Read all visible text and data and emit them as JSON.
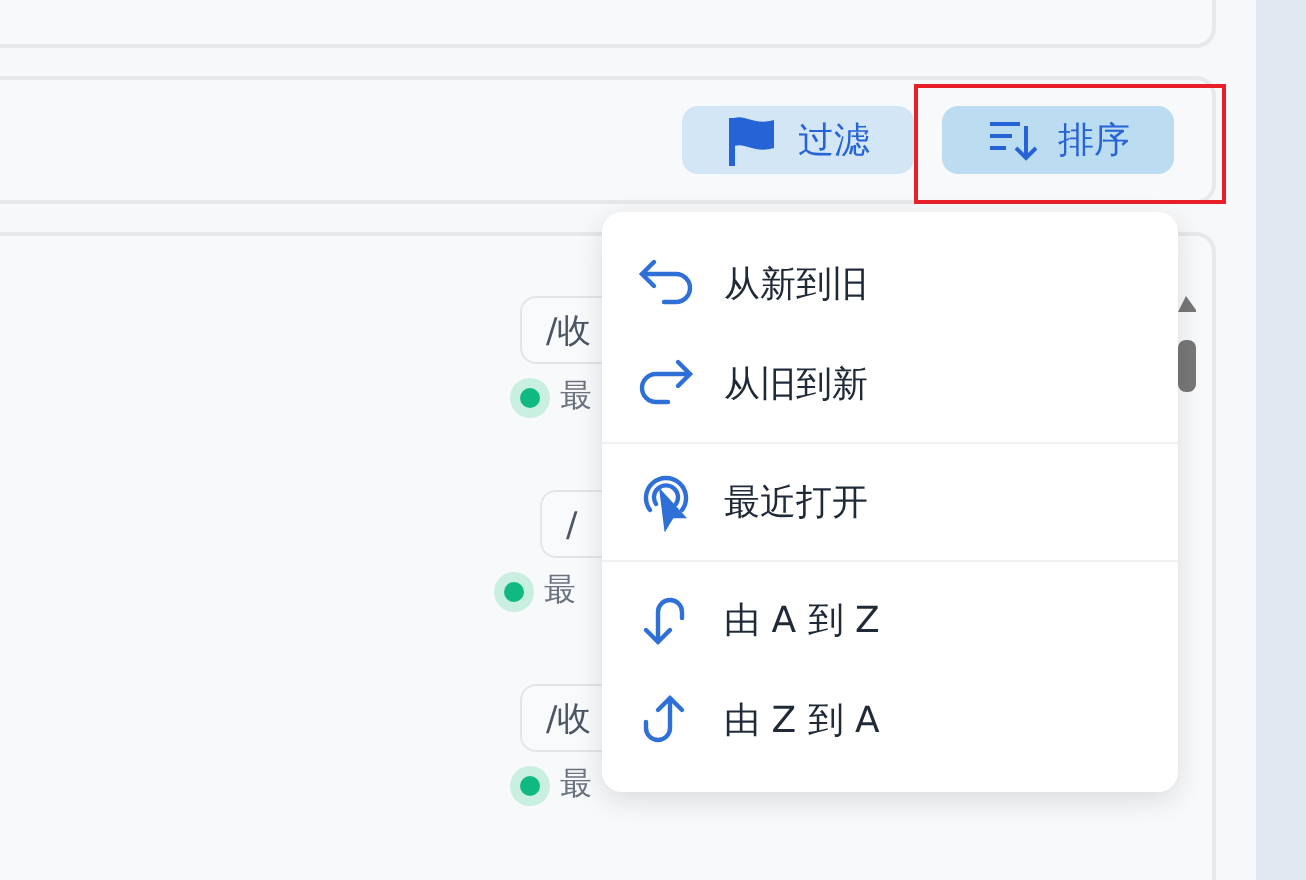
{
  "toolbar": {
    "buttons": [
      {
        "label": "过滤",
        "kind": "filter",
        "selected": false
      },
      {
        "label": "排序",
        "kind": "sort",
        "selected": true
      }
    ]
  },
  "items": [
    {
      "path": "/收",
      "status": "最"
    },
    {
      "path": "/",
      "status": "最"
    },
    {
      "path": "/收",
      "status": "最"
    }
  ],
  "sort_menu": {
    "groups": [
      [
        {
          "label": "从新到旧",
          "kind": "newest"
        },
        {
          "label": "从旧到新",
          "kind": "oldest"
        }
      ],
      [
        {
          "label": "最近打开",
          "kind": "recent"
        }
      ],
      [
        {
          "label": "由 A 到 Z",
          "kind": "az"
        },
        {
          "label": "由 Z 到 A",
          "kind": "za"
        }
      ]
    ]
  }
}
